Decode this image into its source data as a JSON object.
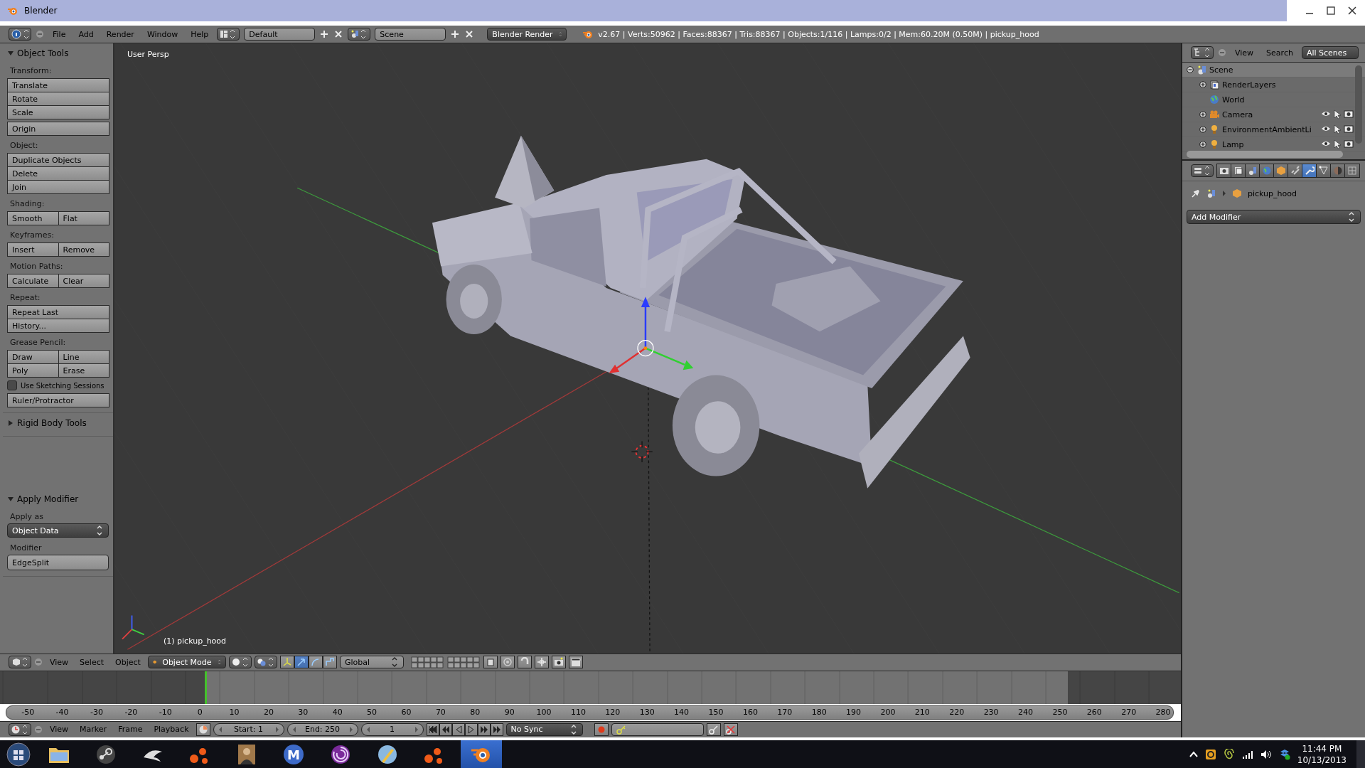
{
  "window": {
    "title": "Blender"
  },
  "info_header": {
    "menus": [
      "File",
      "Add",
      "Render",
      "Window",
      "Help"
    ],
    "layout": "Default",
    "scene": "Scene",
    "render_engine": "Blender Render",
    "stats": "v2.67 | Verts:50962 | Faces:88367 | Tris:88367 | Objects:1/116 | Lamps:0/2 | Mem:60.20M (0.50M) | pickup_hood"
  },
  "tool_shelf": {
    "panels": [
      {
        "title": "Object Tools",
        "expanded": true,
        "items": [
          {
            "kind": "label",
            "text": "Transform:"
          },
          {
            "kind": "buttons",
            "rows": [
              [
                "Translate"
              ],
              [
                "Rotate"
              ],
              [
                "Scale"
              ]
            ]
          },
          {
            "kind": "buttons",
            "rows": [
              [
                "Origin"
              ]
            ]
          },
          {
            "kind": "label",
            "text": "Object:"
          },
          {
            "kind": "buttons",
            "rows": [
              [
                "Duplicate Objects"
              ],
              [
                "Delete"
              ],
              [
                "Join"
              ]
            ]
          },
          {
            "kind": "label",
            "text": "Shading:"
          },
          {
            "kind": "buttons",
            "rows": [
              [
                "Smooth",
                "Flat"
              ]
            ]
          },
          {
            "kind": "label",
            "text": "Keyframes:"
          },
          {
            "kind": "buttons",
            "rows": [
              [
                "Insert",
                "Remove"
              ]
            ]
          },
          {
            "kind": "label",
            "text": "Motion Paths:"
          },
          {
            "kind": "buttons",
            "rows": [
              [
                "Calculate",
                "Clear"
              ]
            ]
          },
          {
            "kind": "label",
            "text": "Repeat:"
          },
          {
            "kind": "buttons",
            "rows": [
              [
                "Repeat Last"
              ],
              [
                "History..."
              ]
            ]
          },
          {
            "kind": "label",
            "text": "Grease Pencil:"
          },
          {
            "kind": "buttons",
            "rows": [
              [
                "Draw",
                "Line"
              ],
              [
                "Poly",
                "Erase"
              ]
            ]
          },
          {
            "kind": "checkbox",
            "label": "Use Sketching Sessions",
            "checked": false
          },
          {
            "kind": "buttons",
            "rows": [
              [
                "Ruler/Protractor"
              ]
            ]
          }
        ]
      },
      {
        "title": "Rigid Body Tools",
        "expanded": false
      },
      {
        "title": "Apply Modifier",
        "expanded": true,
        "items": [
          {
            "kind": "label",
            "text": "Apply as"
          },
          {
            "kind": "dropdown",
            "value": "Object Data"
          },
          {
            "kind": "label",
            "text": "Modifier"
          },
          {
            "kind": "field",
            "value": "EdgeSplit"
          }
        ]
      }
    ]
  },
  "viewport": {
    "view_name": "User Persp",
    "object_label": "(1) pickup_hood"
  },
  "view3d_header": {
    "menus": [
      "View",
      "Select",
      "Object"
    ],
    "mode": "Object Mode",
    "orientation": "Global",
    "manipulators": [
      {
        "kind": "axes",
        "on": false
      },
      {
        "kind": "translate",
        "on": true
      },
      {
        "kind": "rotate",
        "on": false
      },
      {
        "kind": "scale",
        "on": false
      }
    ]
  },
  "timeline": {
    "ticks": [
      "-50",
      "-40",
      "-30",
      "-20",
      "-10",
      "0",
      "10",
      "20",
      "30",
      "40",
      "50",
      "60",
      "70",
      "80",
      "90",
      "100",
      "110",
      "120",
      "130",
      "140",
      "150",
      "160",
      "170",
      "180",
      "190",
      "200",
      "210",
      "220",
      "230",
      "240",
      "250",
      "260",
      "270",
      "280"
    ]
  },
  "timeline_header": {
    "menus": [
      "View",
      "Marker",
      "Frame",
      "Playback"
    ],
    "start": "Start: 1",
    "end": "End: 250",
    "current_frame": "1",
    "sync": "No Sync"
  },
  "outliner": {
    "menus": [
      "View",
      "Search"
    ],
    "filter": "All Scenes",
    "tree": [
      {
        "label": "Scene",
        "kind": "scene",
        "expanded": true,
        "selected": true,
        "children": [
          {
            "label": "RenderLayers",
            "kind": "renderlayers",
            "expanded": false,
            "selected": false
          },
          {
            "label": "World",
            "kind": "world",
            "selected": false
          },
          {
            "label": "Camera",
            "kind": "camera",
            "expanded": false,
            "selected": false
          },
          {
            "label": "EnvironmentAmbientLi",
            "kind": "lamp",
            "expanded": false,
            "selected": false
          },
          {
            "label": "Lamp",
            "kind": "lamp",
            "expanded": false,
            "selected": false
          }
        ]
      }
    ]
  },
  "properties": {
    "tabs": [
      {
        "kind": "render",
        "selected": false
      },
      {
        "kind": "layers",
        "selected": false
      },
      {
        "kind": "scene",
        "selected": false
      },
      {
        "kind": "world",
        "selected": false
      },
      {
        "kind": "object",
        "selected": false
      },
      {
        "kind": "constraints",
        "selected": false
      },
      {
        "kind": "modifiers",
        "selected": true
      },
      {
        "kind": "data",
        "selected": false
      },
      {
        "kind": "material",
        "selected": false
      },
      {
        "kind": "texture",
        "selected": false
      }
    ],
    "context_object": "pickup_hood",
    "add_modifier": "Add Modifier"
  },
  "taskbar": {
    "apps": [
      {
        "kind": "folder",
        "selected": false
      },
      {
        "kind": "steam",
        "selected": false
      },
      {
        "kind": "bird",
        "selected": false
      },
      {
        "kind": "dots",
        "selected": false
      },
      {
        "kind": "portrait",
        "selected": false
      },
      {
        "kind": "letter",
        "text": "M",
        "selected": false
      },
      {
        "kind": "swirl",
        "selected": false
      },
      {
        "kind": "brush",
        "selected": false
      },
      {
        "kind": "dots",
        "selected": false
      },
      {
        "kind": "blender",
        "selected": true
      }
    ],
    "time": "11:44 PM",
    "date": "10/13/2013"
  }
}
